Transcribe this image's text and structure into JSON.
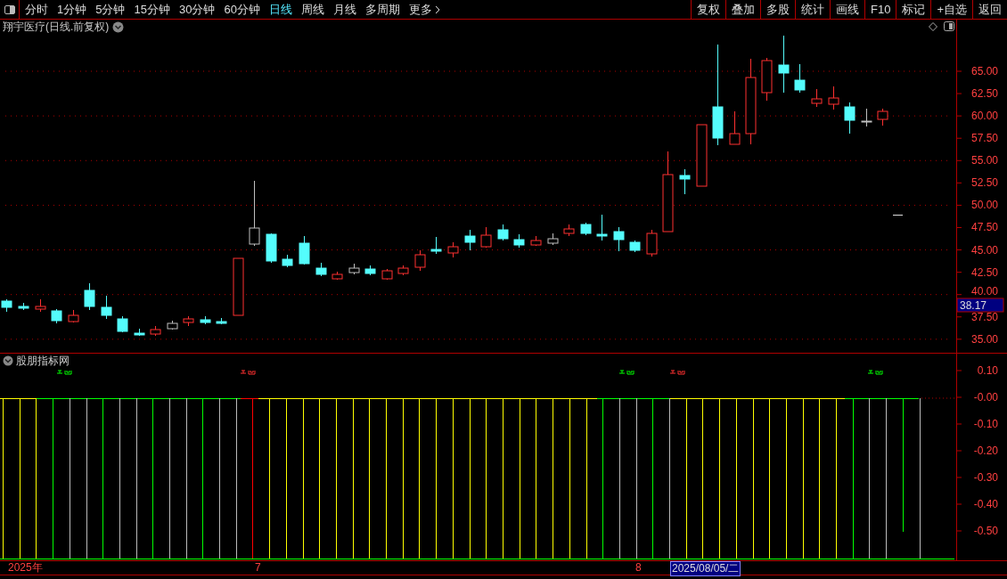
{
  "toolbar": {
    "periods": [
      {
        "label": "分时",
        "selected": false
      },
      {
        "label": "1分钟",
        "selected": false
      },
      {
        "label": "5分钟",
        "selected": false
      },
      {
        "label": "15分钟",
        "selected": false
      },
      {
        "label": "30分钟",
        "selected": false
      },
      {
        "label": "60分钟",
        "selected": false
      },
      {
        "label": "日线",
        "selected": true
      },
      {
        "label": "周线",
        "selected": false
      },
      {
        "label": "月线",
        "selected": false
      },
      {
        "label": "多周期",
        "selected": false
      }
    ],
    "more": "更多",
    "buttons": [
      "复权",
      "叠加",
      "多股",
      "统计",
      "画线",
      "F10",
      "标记",
      "+自选",
      "返回"
    ]
  },
  "price_chart": {
    "title": "翔宇医疗(日线.前复权)",
    "axis_labels": [
      "65.00",
      "62.50",
      "60.00",
      "57.50",
      "55.00",
      "52.50",
      "50.00",
      "47.50",
      "45.00",
      "42.50",
      "40.00",
      "37.50",
      "35.00"
    ],
    "current_price": "38.17"
  },
  "indicator": {
    "title": "股朋指标网",
    "axis_labels": [
      "0.10",
      "-0.00",
      "-0.10",
      "-0.20",
      "-0.30",
      "-0.40",
      "-0.50"
    ]
  },
  "date_bar": [
    {
      "label": "2025年",
      "selected": false
    },
    {
      "label": "7",
      "selected": false
    },
    {
      "label": "8",
      "selected": false
    },
    {
      "label": "2025/08/05/二",
      "selected": true
    }
  ]
}
